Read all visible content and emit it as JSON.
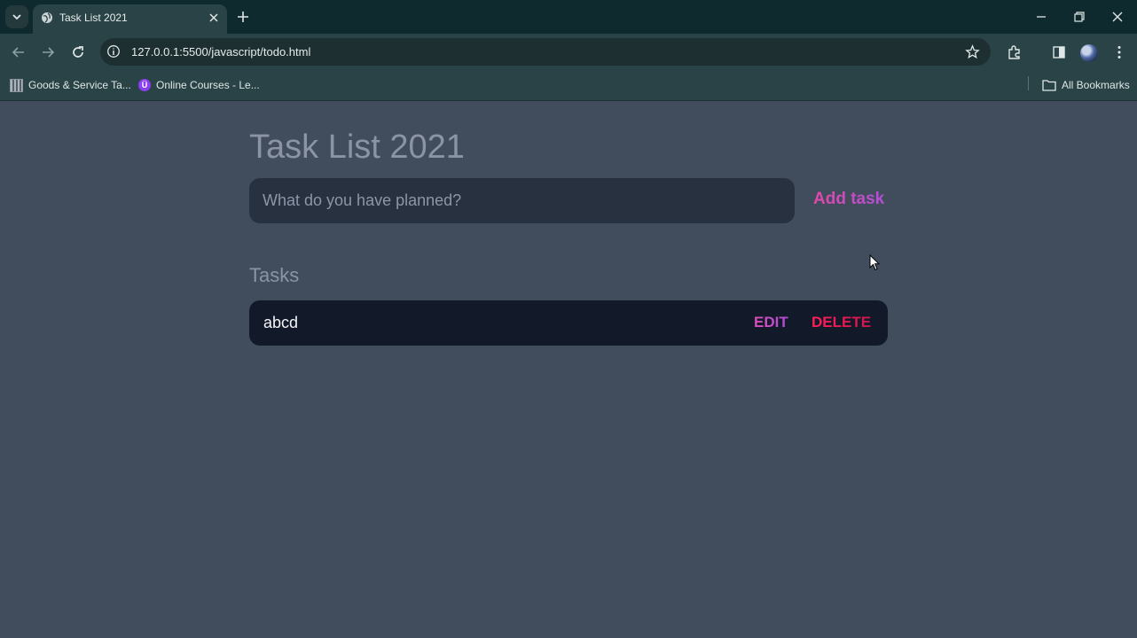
{
  "browser": {
    "tab_title": "Task List 2021",
    "url": "127.0.0.1:5500/javascript/todo.html",
    "bookmarks": [
      {
        "label": "Goods & Service Ta...",
        "icon": "site-icon"
      },
      {
        "label": "Online Courses - Le...",
        "icon": "udemy-icon"
      }
    ],
    "all_bookmarks_label": "All Bookmarks"
  },
  "app": {
    "title": "Task List 2021",
    "input_placeholder": "What do you have planned?",
    "add_button_label": "Add task",
    "section_title": "Tasks",
    "tasks": [
      {
        "text": "abcd",
        "edit_label": "EDIT",
        "delete_label": "DELETE"
      }
    ]
  },
  "colors": {
    "page_background": "#414c5d",
    "input_background": "#283140",
    "task_background": "#121a2a",
    "edit_accent": "#c94fcf",
    "delete_accent": "#ff1f5a"
  }
}
